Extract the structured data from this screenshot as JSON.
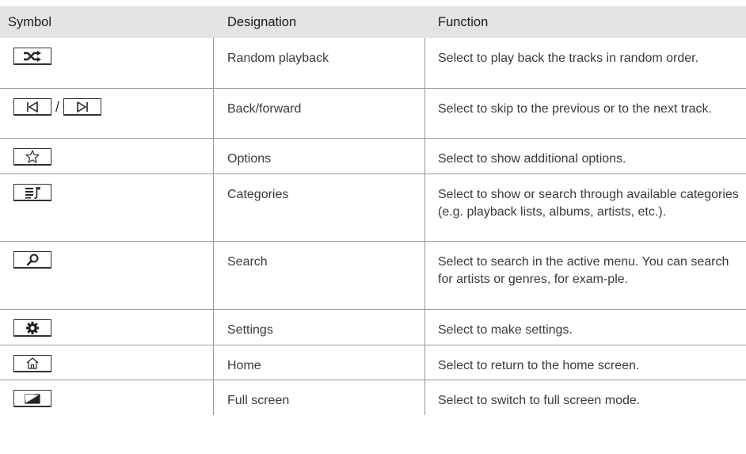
{
  "table": {
    "headers": {
      "symbol": "Symbol",
      "designation": "Designation",
      "function": "Function"
    },
    "rows": [
      {
        "icon": "shuffle-icon",
        "designation": "Random playback",
        "function": "Select to play back the tracks in random order."
      },
      {
        "icon": "skip-back-forward-icon",
        "designation": "Back/forward",
        "function": "Select to skip to the previous or to the next track."
      },
      {
        "icon": "star-icon",
        "designation": "Options",
        "function": "Select to show additional options."
      },
      {
        "icon": "playlist-icon",
        "designation": "Categories",
        "function": "Select to show or search through available categories (e.g. playback lists, albums, artists, etc.)."
      },
      {
        "icon": "search-icon",
        "designation": "Search",
        "function": "Select to search in the active menu. You can search for artists or genres, for exam-ple."
      },
      {
        "icon": "gear-icon",
        "designation": "Settings",
        "function": "Select to make settings."
      },
      {
        "icon": "home-icon",
        "designation": "Home",
        "function": "Select to return to the home screen."
      },
      {
        "icon": "fullscreen-icon",
        "designation": "Full screen",
        "function": "Select to switch to full screen mode."
      }
    ],
    "symbol_separator": "/"
  }
}
